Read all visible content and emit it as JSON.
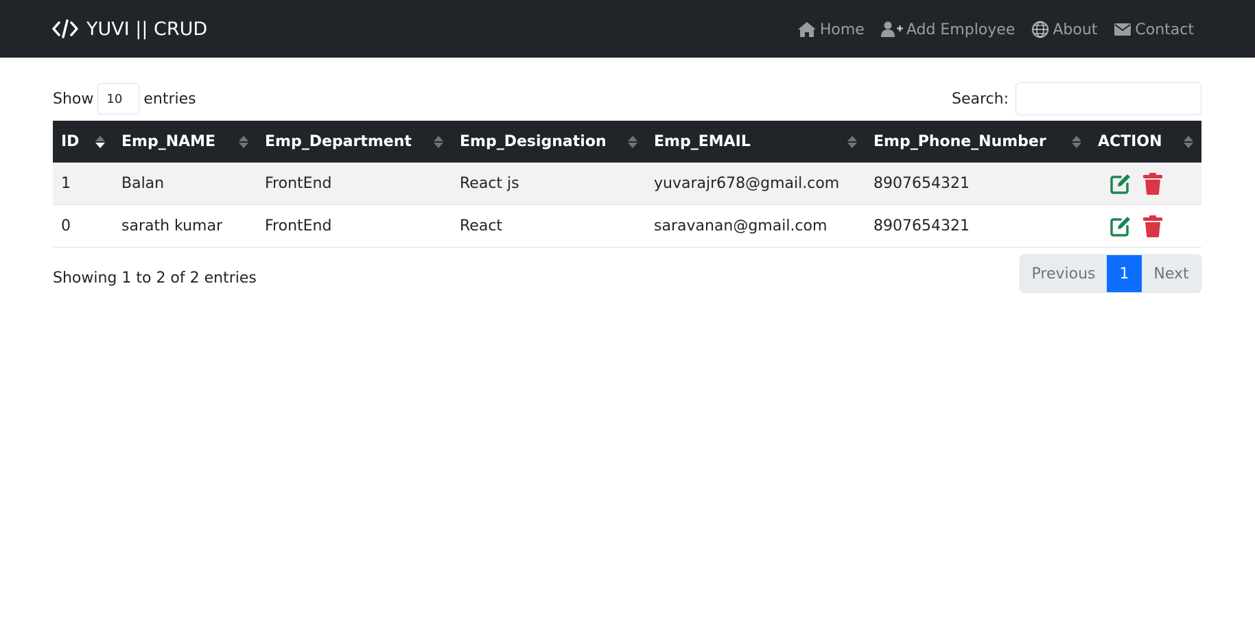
{
  "brand": {
    "title": "YUVI || CRUD",
    "icon": "code-icon"
  },
  "nav": [
    {
      "label": "Home",
      "icon": "home-icon"
    },
    {
      "label": "Add Employee",
      "icon": "user-plus-icon"
    },
    {
      "label": "About",
      "icon": "globe-icon"
    },
    {
      "label": "Contact",
      "icon": "envelope-icon"
    }
  ],
  "table_controls": {
    "show_label": "Show",
    "entries_value": "10",
    "entries_label": "entries",
    "search_label": "Search:",
    "search_value": ""
  },
  "table": {
    "columns": [
      "ID",
      "Emp_NAME",
      "Emp_Department",
      "Emp_Designation",
      "Emp_EMAIL",
      "Emp_Phone_Number",
      "ACTION"
    ],
    "sorted_column": "ID",
    "sort_direction": "ascending",
    "rows": [
      {
        "id": "1",
        "name": "Balan",
        "department": "FrontEnd",
        "designation": "React js",
        "email": "yuvarajr678@gmail.com",
        "phone": "8907654321"
      },
      {
        "id": "0",
        "name": "sarath kumar",
        "department": "FrontEnd",
        "designation": "React",
        "email": "saravanan@gmail.com",
        "phone": "8907654321"
      }
    ],
    "actions": [
      {
        "icon": "edit-icon",
        "color": "#198754"
      },
      {
        "icon": "trash-icon",
        "color": "#dc3545"
      }
    ]
  },
  "footer": {
    "info": "Showing 1 to 2 of 2 entries",
    "prev_label": "Previous",
    "current_page": "1",
    "next_label": "Next"
  },
  "colors": {
    "navbar": "#212529",
    "accent": "#0d6efd",
    "edit": "#198754",
    "delete": "#dc3545"
  }
}
